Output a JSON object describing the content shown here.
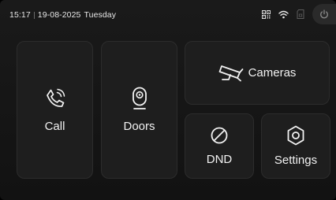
{
  "status_bar": {
    "time": "15:17",
    "date": "19-08-2025",
    "weekday": "Tuesday",
    "icons": [
      "qr-code-icon",
      "wifi-icon",
      "sd-card-icon",
      "power-icon"
    ]
  },
  "tiles": {
    "call": {
      "label": "Call",
      "icon": "phone-ringing-icon"
    },
    "doors": {
      "label": "Doors",
      "icon": "doorbell-camera-icon"
    },
    "cameras": {
      "label": "Cameras",
      "icon": "cctv-camera-icon"
    },
    "dnd": {
      "label": "DND",
      "icon": "do-not-disturb-icon"
    },
    "settings": {
      "label": "Settings",
      "icon": "hexagon-settings-icon"
    }
  },
  "colors": {
    "background": "#121212",
    "tile": "#1e1e1e",
    "text": "#f2f2f2",
    "muted_icon": "#5c5c5c"
  }
}
